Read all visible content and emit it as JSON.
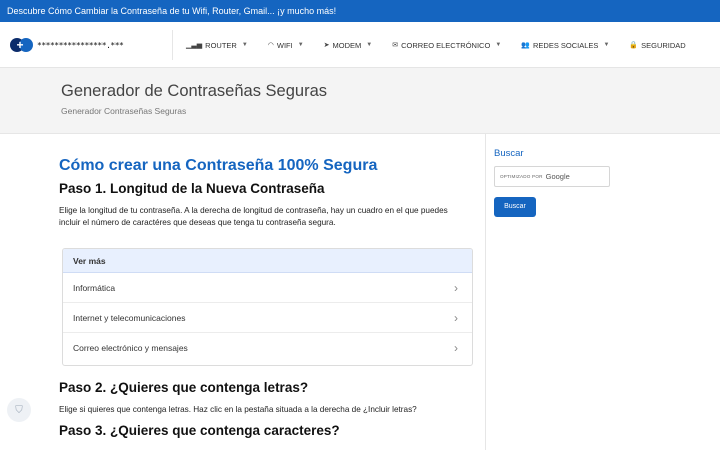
{
  "topbar": {
    "text": "Descubre Cómo Cambiar la Contraseña de tu Wifi, Router, Gmail... ¡y mucho más!"
  },
  "logo": {
    "text": "****************.***"
  },
  "menu": [
    {
      "label": "ROUTER",
      "icon": "signal-bars-icon",
      "glyph": "▁▃▅"
    },
    {
      "label": "WIFI",
      "icon": "wifi-icon",
      "glyph": "◠"
    },
    {
      "label": "MODEM",
      "icon": "location-arrow-icon",
      "glyph": "➤"
    },
    {
      "label": "CORREO ELECTRÓNICO",
      "icon": "envelope-icon",
      "glyph": "✉"
    },
    {
      "label": "REDES SOCIALES",
      "icon": "users-icon",
      "glyph": "👥"
    },
    {
      "label": "SEGURIDAD",
      "icon": "lock-icon",
      "glyph": "🔒"
    }
  ],
  "hero": {
    "title": "Generador de Contraseñas Seguras",
    "breadcrumb": "Generador Contraseñas Seguras"
  },
  "main": {
    "heading": "Cómo crear una Contraseña 100% Segura",
    "step1": {
      "title": "Paso 1. Longitud de la Nueva Contraseña",
      "text": "Elige la longitud de tu contraseña. A la derecha de longitud de contraseña, hay un cuadro en el que puedes incluir el número de caractéres que deseas que tenga tu contraseña segura."
    },
    "box": {
      "header": "Ver más",
      "items": [
        "Informática",
        "Internet y telecomunicaciones",
        "Correo electrónico y mensajes"
      ]
    },
    "step2": {
      "title": "Paso 2. ¿Quieres que contenga letras?",
      "text": "Elige si quieres que contenga letras. Haz clic en la pestaña situada a la derecha de ¿Incluir letras?"
    },
    "step3": {
      "title": "Paso 3. ¿Quieres que contenga caracteres?"
    }
  },
  "sidebar": {
    "title": "Buscar",
    "search": {
      "optimized": "OPTIMIZADO POR",
      "brand": "Google"
    },
    "button": "Buscar"
  },
  "colors": {
    "accent": "#1565c0",
    "hero_bg": "#f4f4f4"
  }
}
